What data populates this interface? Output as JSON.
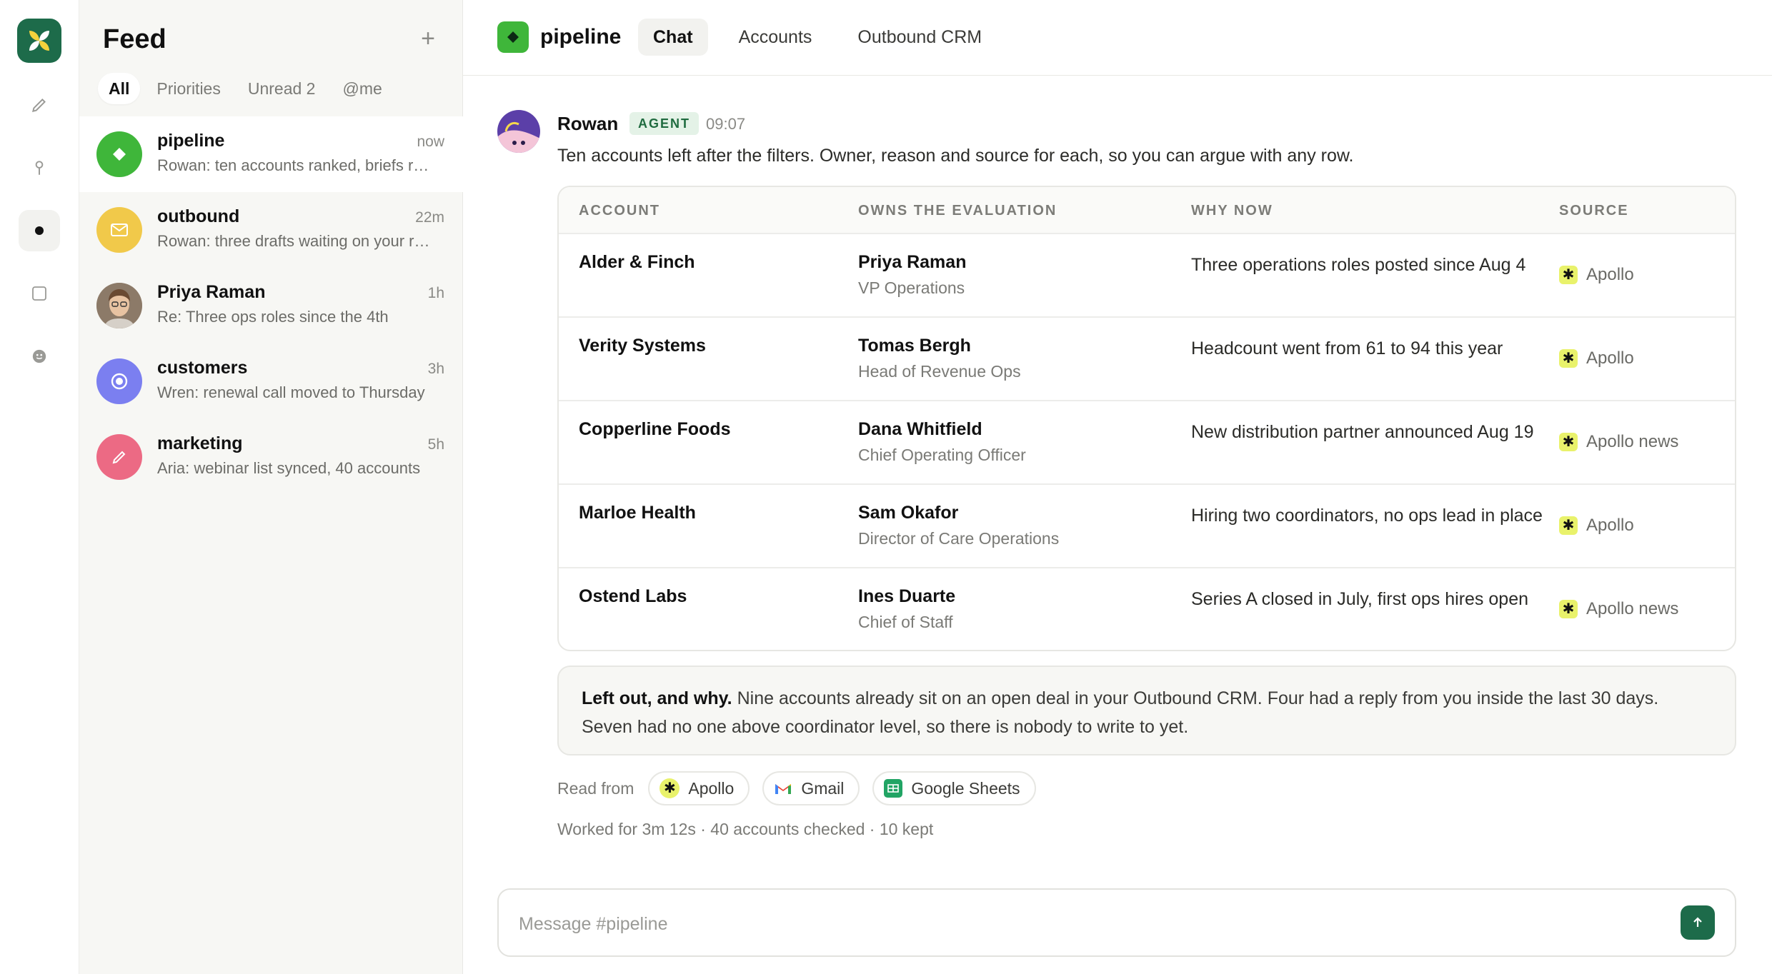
{
  "rail": {
    "items": [
      {
        "icon": "pencil-icon"
      },
      {
        "icon": "pin-icon"
      },
      {
        "icon": "dot-icon"
      },
      {
        "icon": "square-icon"
      },
      {
        "icon": "smiley-icon"
      }
    ]
  },
  "feed": {
    "title": "Feed",
    "add_label": "+",
    "tabs": [
      "All",
      "Priorities",
      "Unread 2",
      "@me"
    ],
    "items": [
      {
        "name": "pipeline",
        "time": "now",
        "preview": "Rowan: ten accounts ranked, briefs ready",
        "color": "#3fb63a"
      },
      {
        "name": "outbound",
        "time": "22m",
        "preview": "Rowan: three drafts waiting on your review",
        "color": "#f1c94a"
      },
      {
        "name": "Priya Raman",
        "time": "1h",
        "preview": "Re: Three ops roles since the 4th",
        "color": "#6b4a38"
      },
      {
        "name": "customers",
        "time": "3h",
        "preview": "Wren: renewal call moved to Thursday",
        "color": "#7b7ff0"
      },
      {
        "name": "marketing",
        "time": "5h",
        "preview": "Aria: webinar list synced, 40 accounts",
        "color": "#ec6a84"
      }
    ]
  },
  "channel": {
    "name": "pipeline",
    "tabs": [
      "Chat",
      "Accounts",
      "Outbound CRM"
    ]
  },
  "message": {
    "author": "Rowan",
    "badge": "AGENT",
    "time": "09:07",
    "text": "Ten accounts left after the filters. Owner, reason and source for each, so you can argue with any row."
  },
  "table": {
    "headers": [
      "ACCOUNT",
      "OWNS THE EVALUATION",
      "WHY NOW",
      "SOURCE"
    ],
    "rows": [
      {
        "account": "Alder & Finch",
        "owner": "Priya Raman",
        "role": "VP Operations",
        "why": "Three operations roles posted since Aug 4",
        "source": "Apollo"
      },
      {
        "account": "Verity Systems",
        "owner": "Tomas Bergh",
        "role": "Head of Revenue Ops",
        "why": "Headcount went from 61 to 94 this year",
        "source": "Apollo"
      },
      {
        "account": "Copperline Foods",
        "owner": "Dana Whitfield",
        "role": "Chief Operating Officer",
        "why": "New distribution partner announced Aug 19",
        "source": "Apollo news"
      },
      {
        "account": "Marloe Health",
        "owner": "Sam Okafor",
        "role": "Director of Care Operations",
        "why": "Hiring two coordinators, no ops lead in place",
        "source": "Apollo"
      },
      {
        "account": "Ostend Labs",
        "owner": "Ines Duarte",
        "role": "Chief of Staff",
        "why": "Series A closed in July, first ops hires open",
        "source": "Apollo news"
      }
    ]
  },
  "note": {
    "lead": "Left out, and why.",
    "text": " Nine accounts already sit on an open deal in your Outbound CRM. Four had a reply from you inside the last 30 days. Seven had no one above coordinator level, so there is nobody to write to yet."
  },
  "read_from": {
    "label": "Read from",
    "sources": [
      "Apollo",
      "Gmail",
      "Google Sheets"
    ]
  },
  "worked": "Worked for 3m 12s · 40 accounts checked · 10 kept",
  "composer": {
    "placeholder": "Message #pipeline"
  },
  "colors": {
    "brand": "#1d6b4a",
    "channel_green": "#3fb63a",
    "badge_bg": "#e4f2e7",
    "badge_text": "#1f6b3f",
    "apollo": "#e9f26b"
  }
}
